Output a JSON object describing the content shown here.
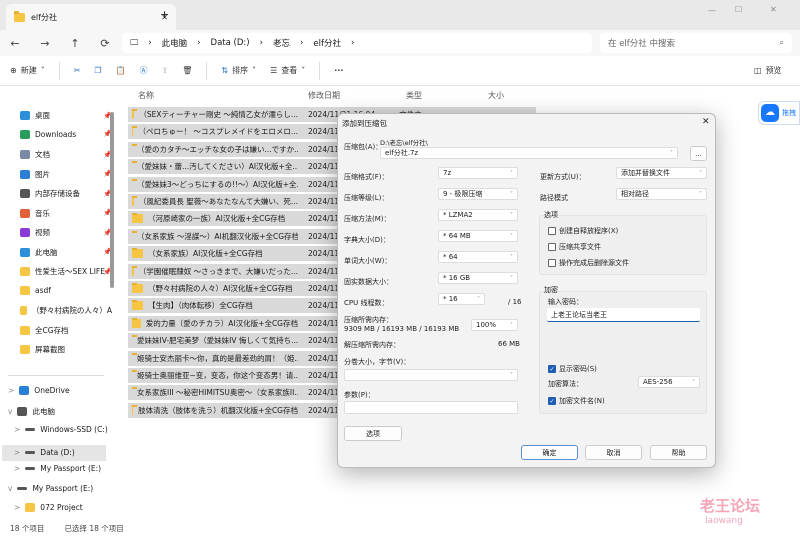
{
  "window": {
    "tab_title": "elf分社",
    "new_tab": "+",
    "min": "—",
    "max": "☐",
    "close": "✕"
  },
  "nav": {
    "back": "←",
    "forward": "→",
    "up": "↑",
    "refresh": "⟳"
  },
  "breadcrumb": [
    "此电脑",
    "Data (D:)",
    "老忘",
    "elf分社"
  ],
  "search": {
    "placeholder": "在 elf分社 中搜索"
  },
  "toolbar": {
    "new": "新建",
    "sort": "排序",
    "view": "查看",
    "more": "···",
    "preview": "预览"
  },
  "sidebar": {
    "quick": [
      {
        "label": "桌面",
        "color": "#2a8fd8"
      },
      {
        "label": "Downloads",
        "color": "#2a9d5c"
      },
      {
        "label": "文档",
        "color": "#7a8aa6"
      },
      {
        "label": "图片",
        "color": "#2b7fd6"
      },
      {
        "label": "内部存储设备",
        "color": "#555555"
      },
      {
        "label": "音乐",
        "color": "#e0603a"
      },
      {
        "label": "视频",
        "color": "#8a3ad6"
      },
      {
        "label": "此电脑",
        "color": "#2a8fd8"
      },
      {
        "label": "性爱生活～SEX LIFE",
        "color": "#f6c543"
      },
      {
        "label": "asdf",
        "color": "#f6c543"
      },
      {
        "label": "（野々村病院の人々）A",
        "color": "#f6c543"
      },
      {
        "label": "全CG存档",
        "color": "#f6c543"
      },
      {
        "label": "屏幕截图",
        "color": "#f6c543"
      }
    ],
    "tree": [
      {
        "label": "OneDrive",
        "indent": 0,
        "exp": ">"
      },
      {
        "label": "此电脑",
        "indent": 0,
        "exp": "v"
      },
      {
        "label": "Windows-SSD (C:)",
        "indent": 1,
        "exp": ">"
      },
      {
        "label": "Data (D:)",
        "indent": 1,
        "exp": ">",
        "selected": true
      },
      {
        "label": "My Passport (E:)",
        "indent": 1,
        "exp": ">"
      },
      {
        "label": "My Passport (E:)",
        "indent": 0,
        "exp": "v"
      },
      {
        "label": "072 Project",
        "indent": 1,
        "exp": ">"
      }
    ]
  },
  "columns": {
    "name": "名称",
    "date": "修改日期",
    "type": "类型",
    "size": "大小"
  },
  "files": [
    {
      "name": "（SEXティーチャー剛史 ～純情乙女が濡らし...",
      "date": "2024/11/21 16:04",
      "type": "文件夹"
    },
    {
      "name": "（ペロちゅー！ ～コスプレメイドをエロメロ...",
      "date": "2024/11"
    },
    {
      "name": "（愛のカタチ～エッチな女の子は嫌い...ですか...",
      "date": "2024/11"
    },
    {
      "name": "（愛妹妹・蕾...汚してください）AI汉化版+全...",
      "date": "2024/11"
    },
    {
      "name": "（愛妹妹3～どっちにするの!!～）AI汉化版+全...",
      "date": "2024/11"
    },
    {
      "name": "（風紀委員長 聖薇～あなたなんて大嫌い、死...",
      "date": "2024/11"
    },
    {
      "name": "（河原崎家の一族）AI汉化版+全CG存档",
      "date": "2024/11"
    },
    {
      "name": "（女系家族 ～淫謀～）AI机翻汉化版+全CG存档",
      "date": "2024/11"
    },
    {
      "name": "（女系家族）AI汉化版+全CG存档",
      "date": "2024/11"
    },
    {
      "name": "（学園催眠隷奴 ～さっきまで、大嫌いだった...",
      "date": "2024/11"
    },
    {
      "name": "（野々村病院の人々）AI汉化版+全CG存档",
      "date": "2024/11"
    },
    {
      "name": "【生肉】（肉体転移）全CG存档",
      "date": "2024/11"
    },
    {
      "name": "爱的力量（愛のチカラ）AI汉化版+全CG存档",
      "date": "2024/11"
    },
    {
      "name": "愛妹妹IV-肥宅美梦（愛妹妹IV 悔しくて気持ち...",
      "date": "2024/11"
    },
    {
      "name": "姬骑士安杰丽卡～你，真的是最差劲的屑！（姫...",
      "date": "2024/11"
    },
    {
      "name": "姬骑士奥丽维亚~变，变态，你这个变态男！请...",
      "date": "2024/11"
    },
    {
      "name": "女系家族III ～秘密HIMITSU奥密～（女系家族II...",
      "date": "2024/11"
    },
    {
      "name": "肢体清洗（肢体を洗う）机翻汉化版+全CG存档",
      "date": "2024/11"
    }
  ],
  "status": {
    "count": "18 个项目",
    "selected": "已选择 18 个项目"
  },
  "dialog": {
    "title": "添加到压缩包",
    "close": "✕",
    "archive_label": "压缩包(A)：",
    "archive_path": "D:\\老忘\\elf分社\\",
    "archive_name": "elf分社.7z",
    "browse": "...",
    "format_label": "压缩格式(F)：",
    "format": "7z",
    "level_label": "压缩等级(L)：",
    "level": "9 - 极限压缩",
    "method_label": "压缩方法(M)：",
    "method": "* LZMA2",
    "dict_label": "字典大小(D)：",
    "dict": "* 64 MB",
    "word_label": "单词大小(W)：",
    "word": "* 64",
    "solid_label": "固实数据大小：",
    "solid": "* 16 GB",
    "cpu_label": "CPU 线程数：",
    "cpu": "* 16",
    "cpu_max": "/ 16",
    "mem_label": "压缩所需内存：",
    "mem_values": "9309 MB / 16193 MB / 16193 MB",
    "mem_pct": "100%",
    "dmem_label": "解压缩所需内存：",
    "dmem": "66 MB",
    "split_label": "分卷大小，字节(V)：",
    "split": "",
    "params_label": "参数(P)：",
    "params": "",
    "options_btn": "选项",
    "update_label": "更新方式(U)：",
    "update": "添加并替换文件",
    "path_label": "路径模式",
    "path": "相对路径",
    "options_group": "选项",
    "opt_sfx": "创建自释放程序(X)",
    "opt_shared": "压缩共享文件",
    "opt_delete": "操作完成后删除源文件",
    "enc_group": "加密",
    "pwd_label": "输入密码：",
    "pwd": "上老王论坛当老王",
    "show_pwd": "显示密码(S)",
    "enc_method_label": "加密算法：",
    "enc_method": "AES-256",
    "enc_names": "加密文件名(N)",
    "ok": "确定",
    "cancel": "取消",
    "help": "帮助"
  },
  "baidu": {
    "label": "拖拽"
  },
  "watermark": {
    "cn": "老王论坛",
    "en": "laowang"
  },
  "colors": {
    "accent": "#1e5fb4",
    "selection": "#d9d9d9"
  }
}
